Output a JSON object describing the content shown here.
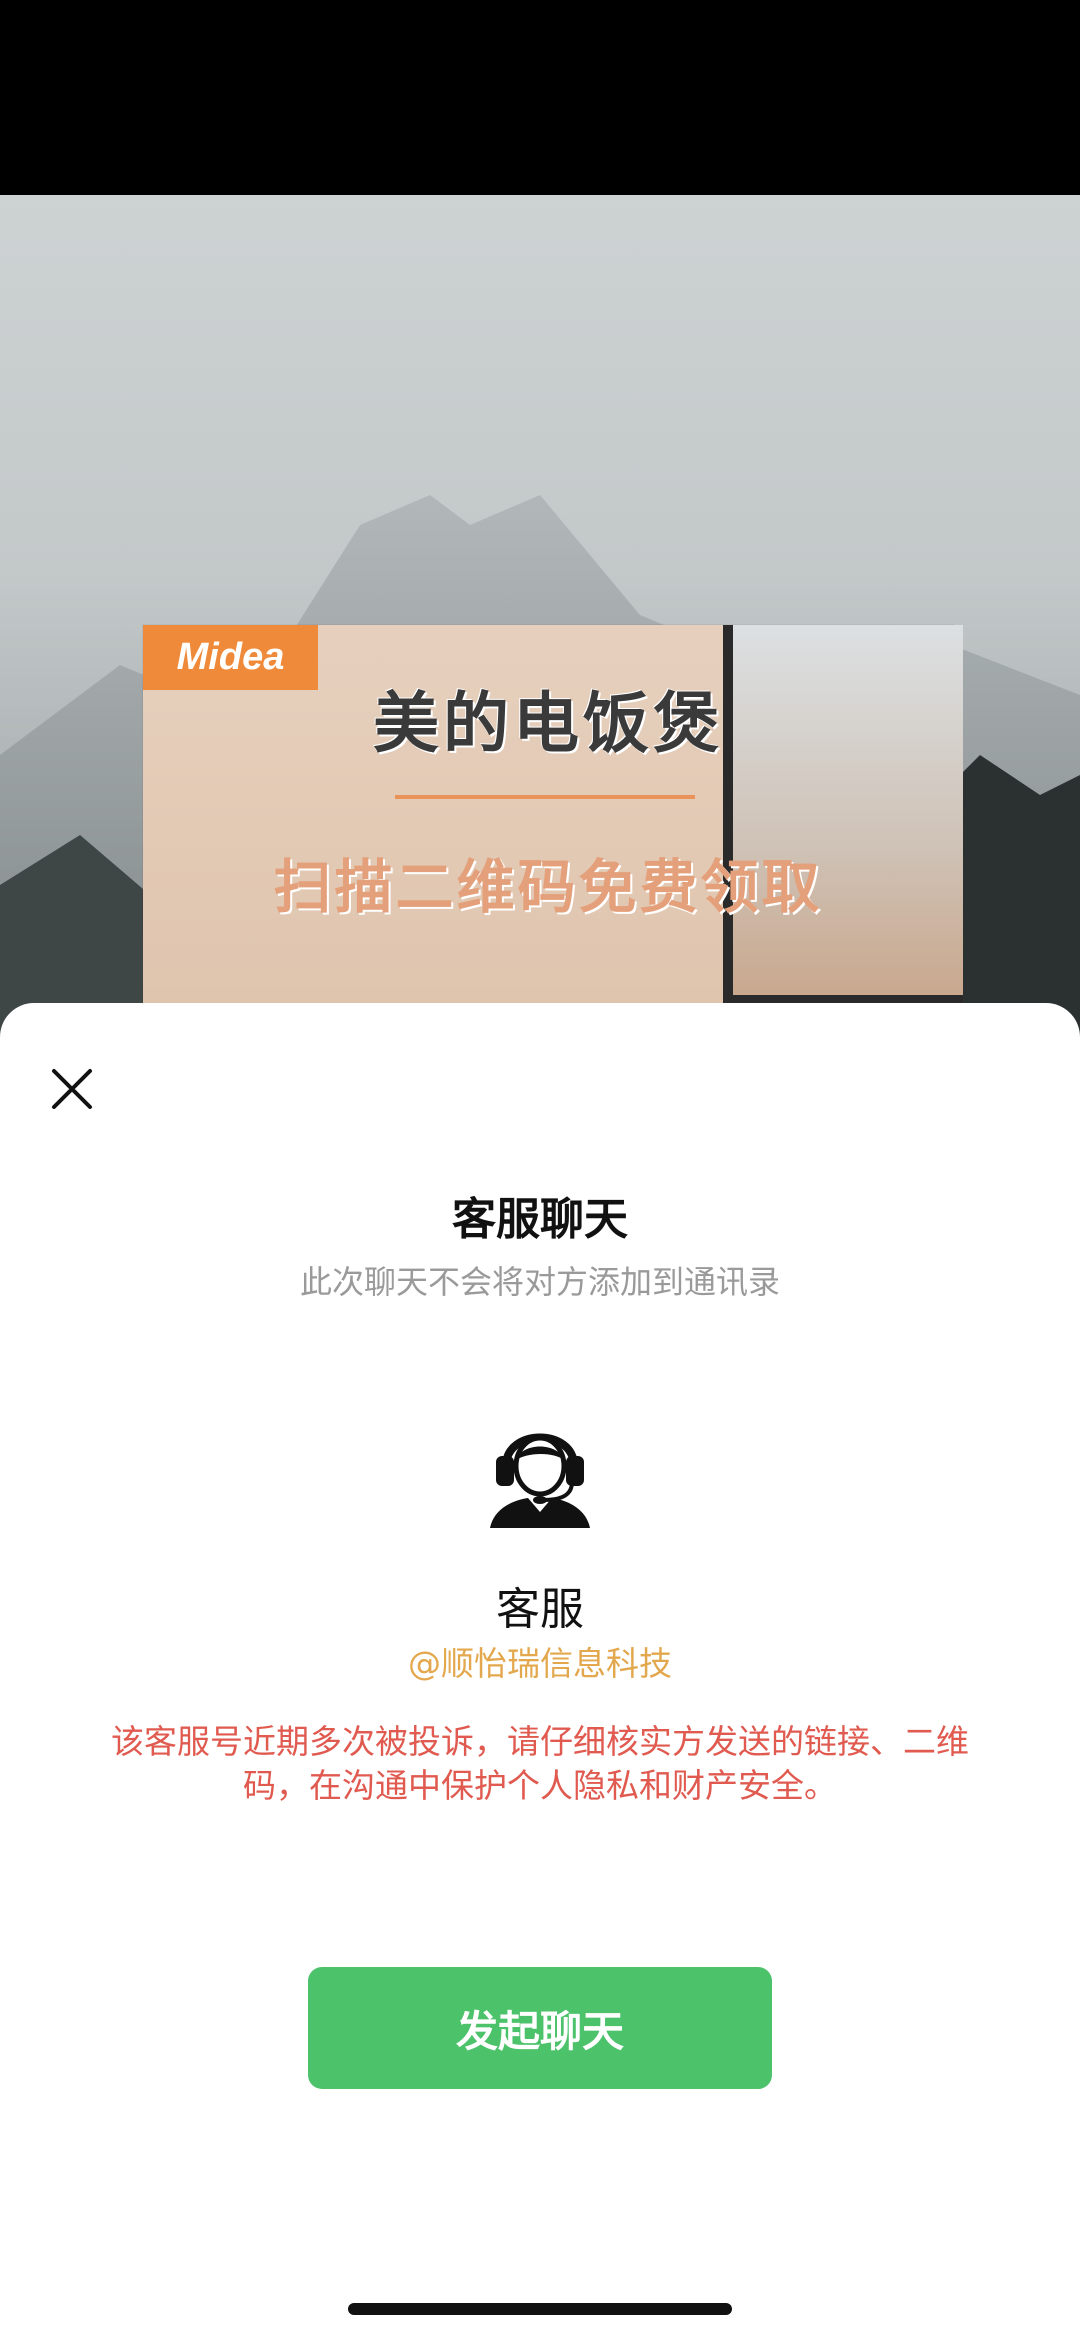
{
  "backdrop": {
    "ad": {
      "logo_text": "Midea",
      "title": "美的电饭煲",
      "subtitle": "扫描二维码免费领取",
      "accent_color": "#ef8a3a"
    }
  },
  "sheet": {
    "close_icon": "close-icon",
    "title": "客服聊天",
    "subtitle": "此次聊天不会将对方添加到通讯录",
    "avatar_icon": "customer-service-headset-icon",
    "name": "客服",
    "company": "@顺怡瑞信息科技",
    "warning": "该客服号近期多次被投诉，请仔细核实方发送的链接、二维码，在沟通中保护个人隐私和财产安全。",
    "start_button": "发起聊天",
    "button_color": "#4cc26b",
    "warning_color": "#e05a50",
    "company_color": "#e3a84e"
  }
}
